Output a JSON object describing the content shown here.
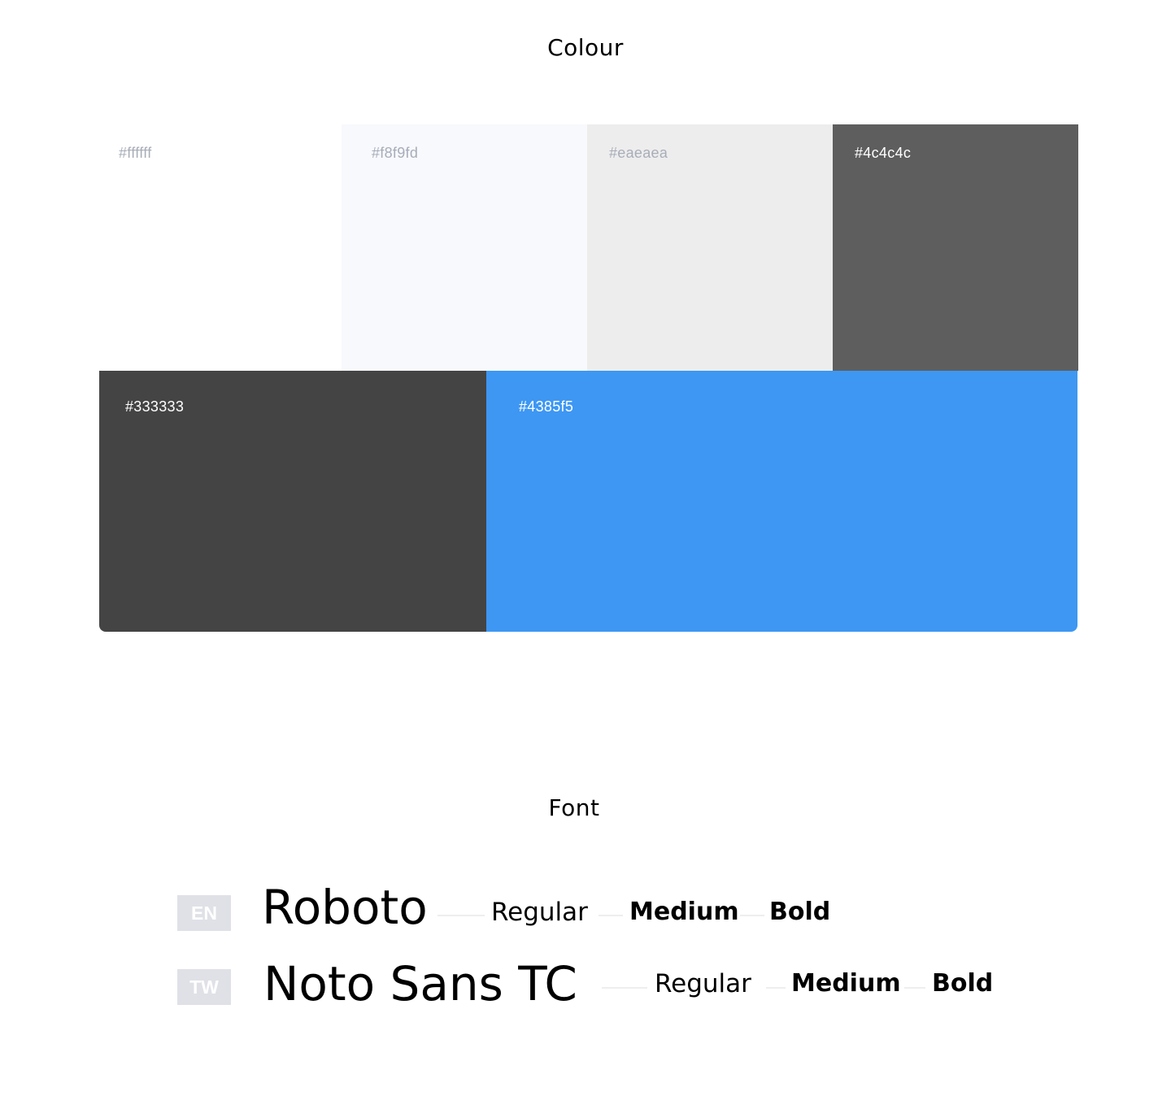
{
  "colour_section": {
    "title": "Colour",
    "swatches": [
      {
        "label": "#ffffff",
        "color": "#ffffff",
        "text_color": "#a8adb8"
      },
      {
        "label": "#f8f9fd",
        "color": "#f8f9fd",
        "text_color": "#a8adb8"
      },
      {
        "label": "#eaeaea",
        "color": "#ededed",
        "text_color": "#a8adb8"
      },
      {
        "label": "#4c4c4c",
        "color": "#5e5e5e",
        "text_color": "#ffffff"
      },
      {
        "label": "#333333",
        "color": "#444444",
        "text_color": "#ffffff"
      },
      {
        "label": "#4385f5",
        "color": "#3d97f3",
        "text_color": "#ffffff"
      }
    ]
  },
  "font_section": {
    "title": "Font",
    "fonts": [
      {
        "lang": "EN",
        "name": "Roboto",
        "weights": [
          "Regular",
          "Medium",
          "Bold"
        ]
      },
      {
        "lang": "TW",
        "name": "Noto Sans TC",
        "weights": [
          "Regular",
          "Medium",
          "Bold"
        ]
      }
    ]
  }
}
